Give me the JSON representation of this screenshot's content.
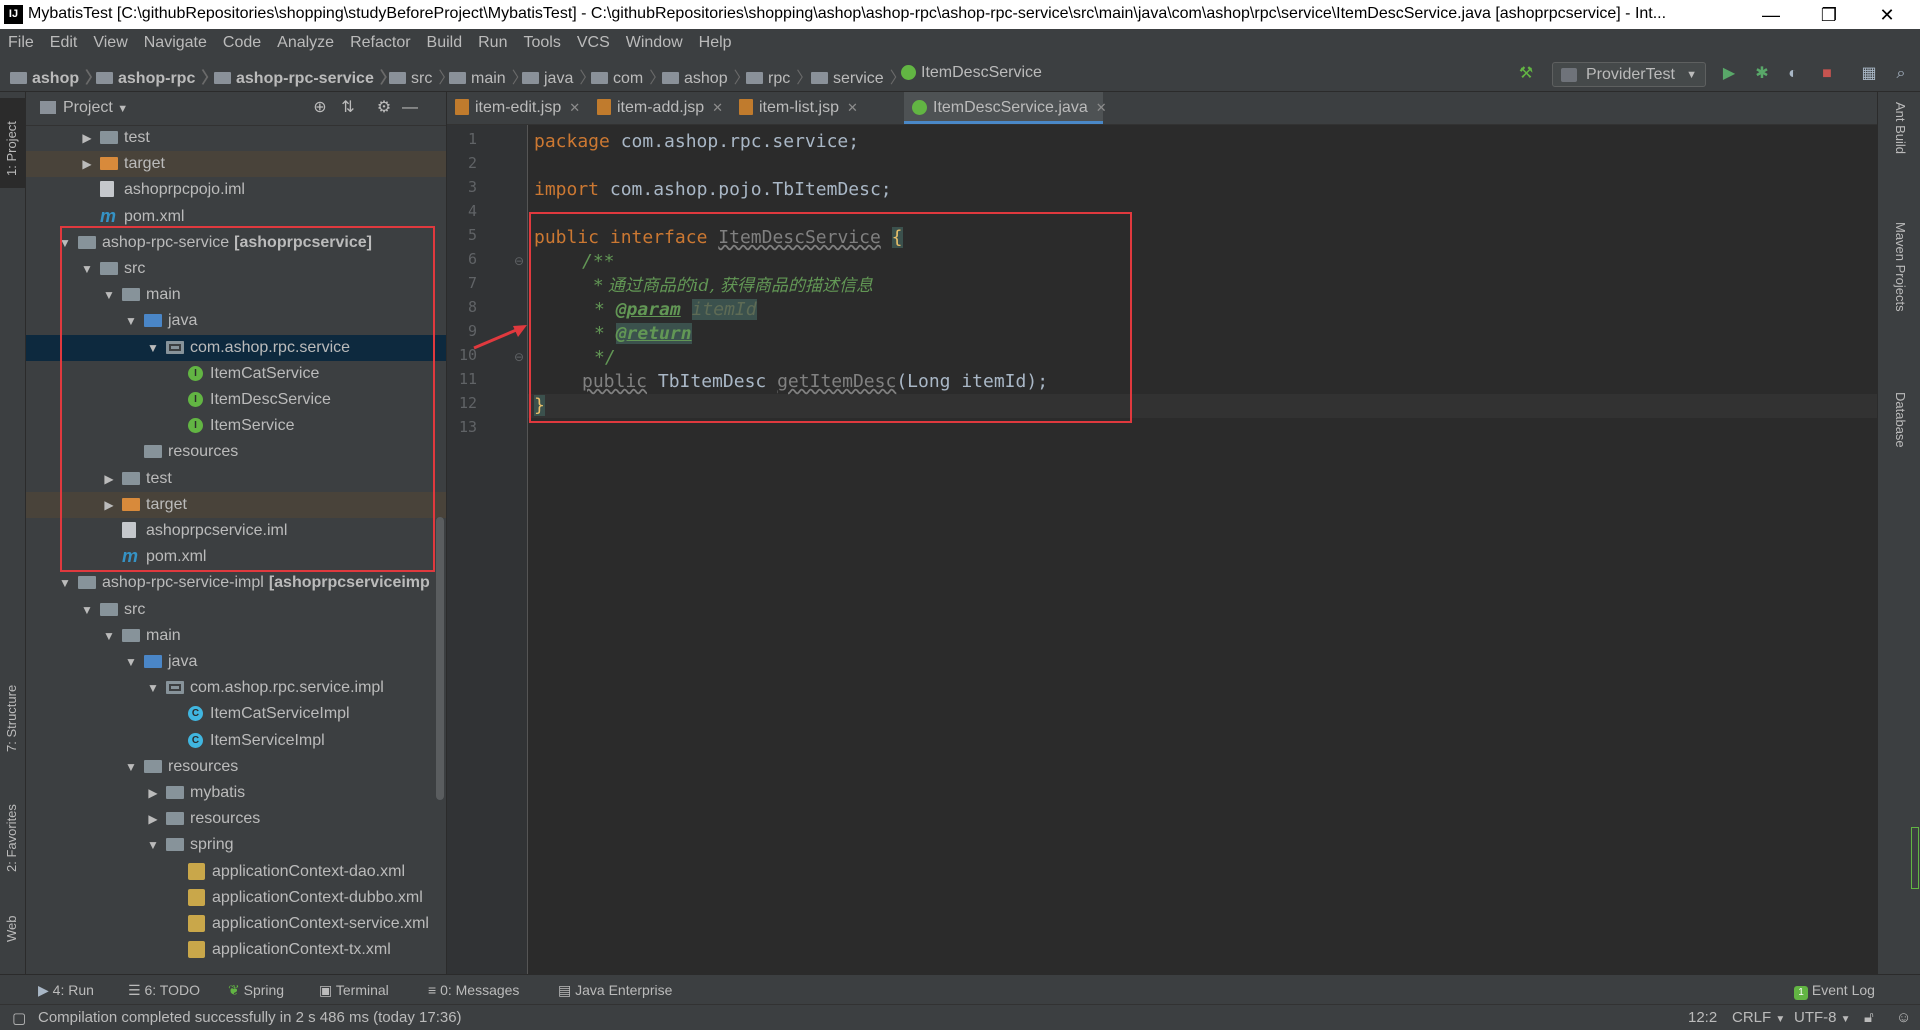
{
  "window": {
    "title": "MybatisTest [C:\\githubRepositories\\shopping\\studyBeforeProject\\MybatisTest] - C:\\githubRepositories\\shopping\\ashop\\ashop-rpc\\ashop-rpc-service\\src\\main\\java\\com\\ashop\\rpc\\service\\ItemDescService.java [ashoprpcservice] - Int...",
    "minimize": "—",
    "maximize": "❐",
    "close": "✕"
  },
  "menu": [
    "File",
    "Edit",
    "View",
    "Navigate",
    "Code",
    "Analyze",
    "Refactor",
    "Build",
    "Run",
    "Tools",
    "VCS",
    "Window",
    "Help"
  ],
  "breadcrumbs": [
    "ashop",
    "ashop-rpc",
    "ashop-rpc-service",
    "src",
    "main",
    "java",
    "com",
    "ashop",
    "rpc",
    "service",
    "ItemDescService"
  ],
  "run_config": "ProviderTest",
  "project_panel": {
    "title": "Project",
    "tree": [
      {
        "label": "test",
        "kind": "folder",
        "arrow": "▶"
      },
      {
        "label": "target",
        "kind": "folder-orange",
        "arrow": "▶",
        "dim": true
      },
      {
        "label": "ashoprpcpojo.iml",
        "kind": "file"
      },
      {
        "label": "pom.xml",
        "kind": "maven"
      },
      {
        "label": "ashop-rpc-service",
        "suffix": "[ashoprpcservice]",
        "kind": "module",
        "arrow": "▼"
      },
      {
        "label": "src",
        "kind": "folder",
        "arrow": "▼"
      },
      {
        "label": "main",
        "kind": "folder",
        "arrow": "▼"
      },
      {
        "label": "java",
        "kind": "folder-src",
        "arrow": "▼"
      },
      {
        "label": "com.ashop.rpc.service",
        "kind": "package",
        "arrow": "▼",
        "selected": true
      },
      {
        "label": "ItemCatService",
        "kind": "interface"
      },
      {
        "label": "ItemDescService",
        "kind": "interface"
      },
      {
        "label": "ItemService",
        "kind": "interface"
      },
      {
        "label": "resources",
        "kind": "folder"
      },
      {
        "label": "test",
        "kind": "folder",
        "arrow": "▶"
      },
      {
        "label": "target",
        "kind": "folder-orange",
        "arrow": "▶",
        "dim": true
      },
      {
        "label": "ashoprpcservice.iml",
        "kind": "file"
      },
      {
        "label": "pom.xml",
        "kind": "maven"
      },
      {
        "label": "ashop-rpc-service-impl",
        "suffix": "[ashoprpcserviceimp",
        "kind": "module",
        "arrow": "▼"
      },
      {
        "label": "src",
        "kind": "folder",
        "arrow": "▼"
      },
      {
        "label": "main",
        "kind": "folder",
        "arrow": "▼"
      },
      {
        "label": "java",
        "kind": "folder-src",
        "arrow": "▼"
      },
      {
        "label": "com.ashop.rpc.service.impl",
        "kind": "package",
        "arrow": "▼"
      },
      {
        "label": "ItemCatServiceImpl",
        "kind": "class"
      },
      {
        "label": "ItemServiceImpl",
        "kind": "class"
      },
      {
        "label": "resources",
        "kind": "folder",
        "arrow": "▼"
      },
      {
        "label": "mybatis",
        "kind": "folder",
        "arrow": "▶"
      },
      {
        "label": "resources",
        "kind": "folder",
        "arrow": "▶"
      },
      {
        "label": "spring",
        "kind": "folder",
        "arrow": "▼"
      },
      {
        "label": "applicationContext-dao.xml",
        "kind": "xml"
      },
      {
        "label": "applicationContext-dubbo.xml",
        "kind": "xml"
      },
      {
        "label": "applicationContext-service.xml",
        "kind": "xml"
      },
      {
        "label": "applicationContext-tx.xml",
        "kind": "xml"
      }
    ]
  },
  "editor": {
    "tabs": [
      {
        "label": "item-edit.jsp",
        "active": false
      },
      {
        "label": "item-add.jsp",
        "active": false
      },
      {
        "label": "item-list.jsp",
        "active": false
      },
      {
        "label": "ItemDescService.java",
        "active": true
      }
    ],
    "line_numbers": [
      "1",
      "2",
      "3",
      "4",
      "5",
      "6",
      "7",
      "8",
      "9",
      "10",
      "11",
      "12",
      "13"
    ],
    "code": {
      "l1_kw": "package",
      "l1_rest": " com.ashop.rpc.service;",
      "l3_kw": "import",
      "l3_rest": " com.ashop.pojo.TbItemDesc;",
      "l5_kw1": "public",
      "l5_kw2": "interface",
      "l5_name": "ItemDescService",
      "l5_brace": "{",
      "l6": "/**",
      "l7": "* 通过商品的id, 获得商品的描述信息",
      "l8_star": "*",
      "l8_tag": "@param",
      "l8_arg": "itemId",
      "l9_star": "*",
      "l9_tag": "@return",
      "l10": "*/",
      "l11_kw": "public",
      "l11_type": "TbItemDesc",
      "l11_method": "getItemDesc",
      "l11_params": "(Long itemId);",
      "l12": "}"
    }
  },
  "right_tools": [
    "Ant Build",
    "Maven Projects",
    "Database"
  ],
  "left_tools": [
    "1: Project",
    "7: Structure",
    "2: Favorites",
    "Web"
  ],
  "bottom_tools": [
    "4: Run",
    "6: TODO",
    "Spring",
    "Terminal",
    "0: Messages",
    "Java Enterprise",
    "Event Log"
  ],
  "status": {
    "message": "Compilation completed successfully in 2 s 486 ms (today 17:36)",
    "position": "12:2",
    "line_sep": "CRLF",
    "encoding": "UTF-8"
  },
  "colors": {
    "bg_editor": "#2b2b2b",
    "bg_panel": "#3c3f41",
    "keyword": "#cc7832",
    "comment": "#629755",
    "annotation_red": "#e0393e",
    "selection": "#0d293e"
  }
}
